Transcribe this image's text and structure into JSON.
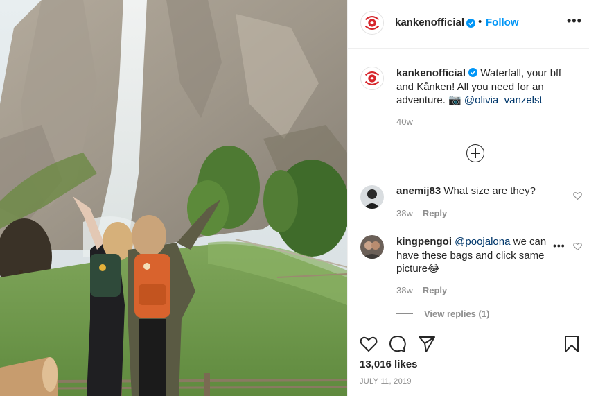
{
  "post": {
    "image_alt": "Two people raising their arms in front of a waterfall cliff, wearing Kanken backpacks",
    "brand_logo_text": "FJÄLLRÄVEN KÅNKEN"
  },
  "header": {
    "username": "kankenofficial",
    "separator": "•",
    "follow_label": "Follow",
    "more_label": "•••"
  },
  "caption": {
    "username": "kankenofficial",
    "text": "Waterfall, your bff and Kånken! All you need for an adventure. 📷 ",
    "mention": "@olivia_vanzelst",
    "time": "40w"
  },
  "comments": [
    {
      "username": "anemij83",
      "text": "What size are they?",
      "time": "38w",
      "reply_label": "Reply"
    },
    {
      "username": "kingpengoi",
      "mention": "@poojalona",
      "text": " we can have these bags and click same picture😂",
      "time": "38w",
      "reply_label": "Reply",
      "more_label": "•••",
      "view_replies": "View replies (1)"
    }
  ],
  "actions": {
    "likes": "13,016 likes",
    "date": "JULY 11, 2019"
  },
  "colors": {
    "accent": "#0095f6",
    "mention": "#00376b",
    "muted": "#8e8e8e",
    "brand_red": "#d7262c"
  }
}
